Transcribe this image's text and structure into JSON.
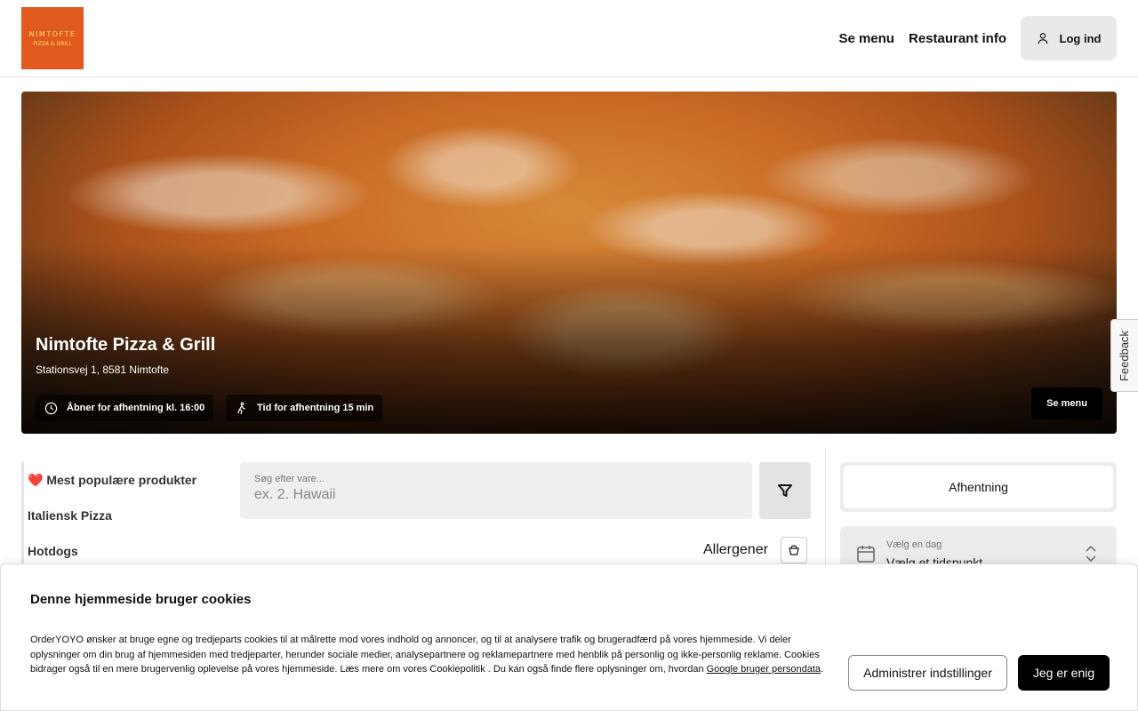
{
  "header": {
    "logo_line1": "NIMTOFTE",
    "logo_line2": "PIZZA & GRILL",
    "nav": {
      "menu": "Se menu",
      "info": "Restaurant info",
      "login": "Log ind"
    }
  },
  "hero": {
    "title": "Nimtofte Pizza & Grill",
    "address": "Stationsvej 1, 8581 Nimtofte",
    "opening": "Åbner for afhentning kl. 16:00",
    "pickup_time": "Tid for afhentning 15 min",
    "menu_button": "Se menu"
  },
  "feedback": "Feedback",
  "categories": [
    {
      "label": "❤️ Mest populære produkter"
    },
    {
      "label": "Italiensk Pizza"
    },
    {
      "label": "Hotdogs"
    }
  ],
  "search": {
    "label": "Søg efter vare...",
    "placeholder": "ex. 2. Hawaii"
  },
  "allergens": {
    "label": "Allergener"
  },
  "order": {
    "mode": "Afhentning",
    "day_label": "Vælg en dag",
    "time_label": "Vælg et tidspunkt"
  },
  "cookie": {
    "title": "Denne hjemmeside bruger cookies",
    "text": "OrderYOYO ønsker at bruge egne og tredjeparts cookies til at målrette mod vores indhold og annoncer, og til at analysere trafik og brugeradfærd på vores hjemmeside. Vi deler oplysninger om din brug af hjemmesiden med tredjeparter, herunder sociale medier, analysepartnere og reklamepartnere med henblik på personlig og ikke-personlig reklame. Cookies bidrager også til en mere brugervenlig oplevelse på vores hjemmeside. Læs mere om vores Cookiepolitik . Du kan også finde flere oplysninger om, hvordan ",
    "link": "Google bruger persondata",
    "end": ".",
    "manage_button": "Administrer indstillinger",
    "agree_button": "Jeg er enig"
  },
  "colors": {
    "brand": "#e05a1f",
    "primary_button": "#000000"
  }
}
